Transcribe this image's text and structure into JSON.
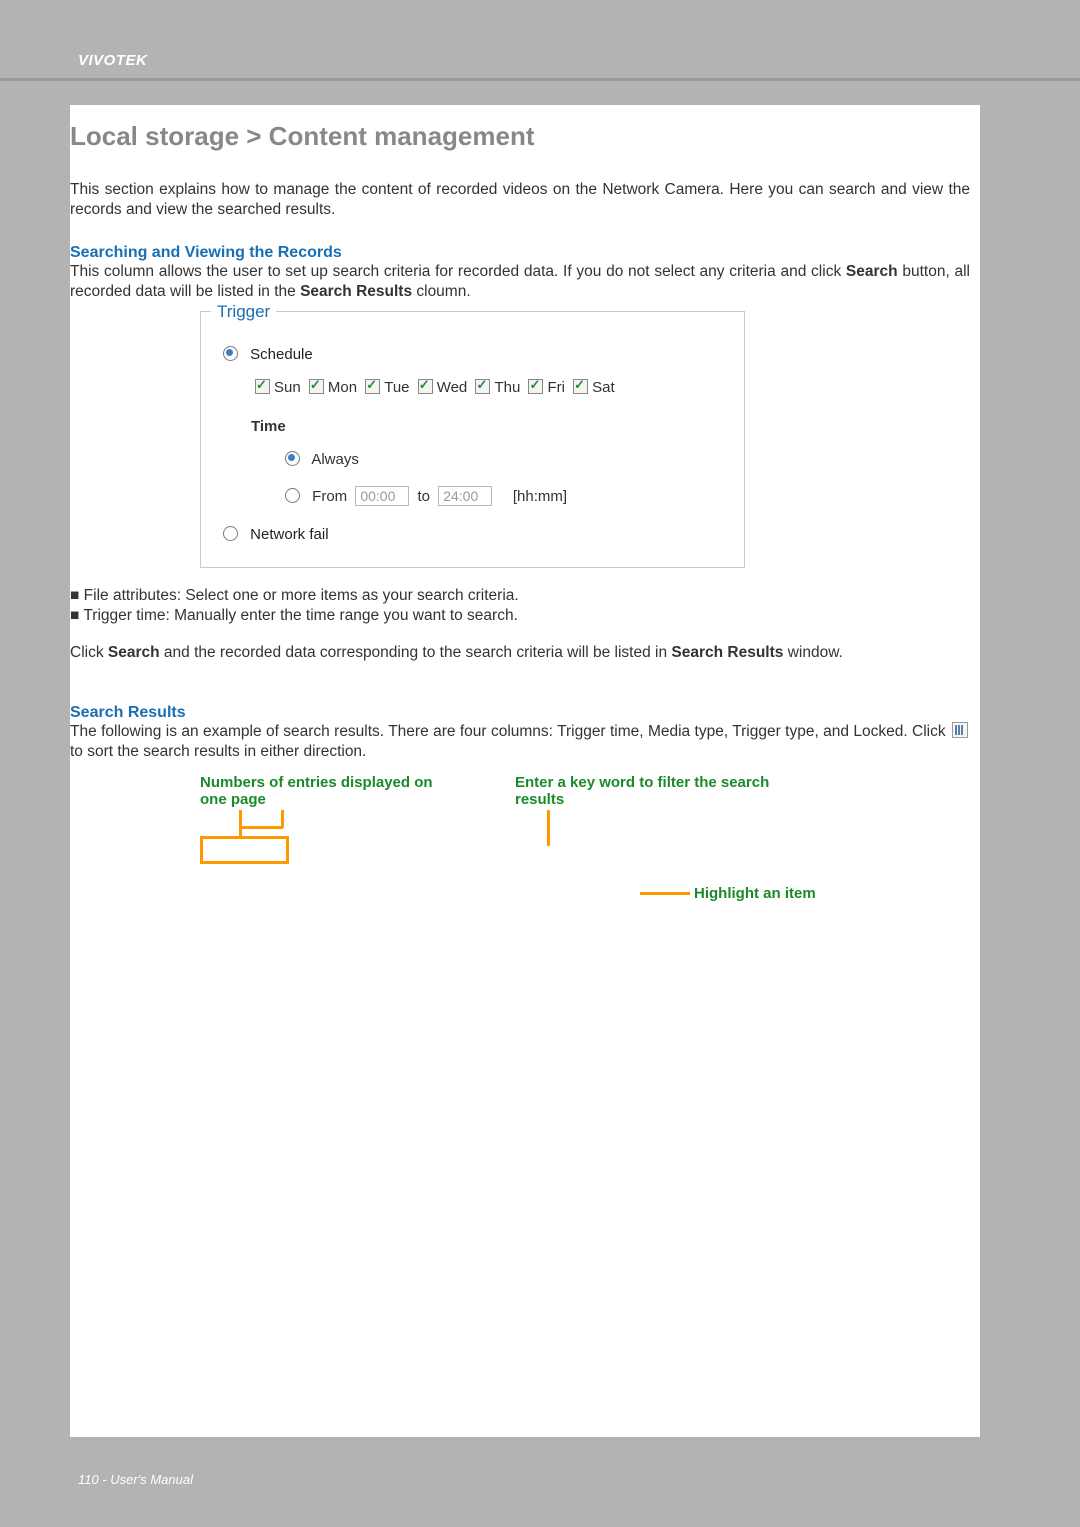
{
  "brand": "VIVOTEK",
  "footer": "110 - User's Manual",
  "h1": "Local storage > Content management",
  "intro": "This section explains how to manage the content of recorded videos on the Network Camera. Here you can search and view the records and view the searched results.",
  "section_searching": {
    "title": "Searching and Viewing the Records",
    "para_parts": {
      "p1": "This column allows the user to set up search criteria for recorded data. If you do not select any criteria and click ",
      "b1": "Search",
      "p2": " button, all recorded data will be listed in the ",
      "b2": "Search Results",
      "p3": " cloumn."
    }
  },
  "trigger": {
    "legend": "Trigger",
    "schedule_label": "Schedule",
    "days": {
      "sun": "Sun",
      "mon": "Mon",
      "tue": "Tue",
      "wed": "Wed",
      "thu": "Thu",
      "fri": "Fri",
      "sat": "Sat"
    },
    "time_label": "Time",
    "always_label": "Always",
    "from_label": "From",
    "from_value": "00:00",
    "to_label": "to",
    "to_value": "24:00",
    "hhmm": "[hh:mm]",
    "network_fail": "Network fail"
  },
  "bullets": {
    "file_attr": "■ File attributes: Select one or more items as your search criteria.",
    "trig_time": "■ Trigger time: Manually enter the time range you want to search."
  },
  "click_search": {
    "p1": "Click ",
    "b1": "Search",
    "p2": " and the recorded data corresponding to the search criteria will be listed in ",
    "b2": "Search Results",
    "p3": " window."
  },
  "section_results": {
    "title": "Search Results",
    "para_pre": "The following is an example of search results. There are four columns: Trigger time, Media type, Trigger type, and Locked. Click ",
    "para_post": " to sort the search results in either direction."
  },
  "callouts": {
    "left": "Numbers of entries displayed on one page",
    "right": "Enter a key word to filter the search results",
    "highlight": "Highlight an item"
  }
}
